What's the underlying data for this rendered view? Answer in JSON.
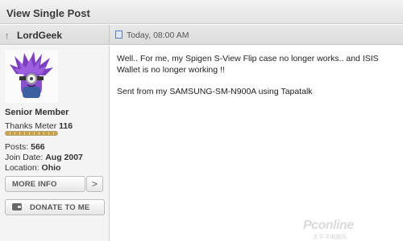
{
  "page": {
    "title": "View Single Post"
  },
  "post": {
    "author": "LordGeek",
    "timestamp": "Today, 08:00 AM",
    "body_line1": "Well.. For me, my Spigen S-View Flip case no longer works.. and ISIS",
    "body_line2": "Wallet is no longer working !!",
    "signature": "Sent from my SAMSUNG-SM-N900A using Tapatalk"
  },
  "user": {
    "rank": "Senior Member",
    "thanks_label": "Thanks Meter",
    "thanks_value": "116",
    "thanks_meter_fraction": 1.0,
    "posts_label": "Posts:",
    "posts_value": "566",
    "join_label": "Join Date:",
    "join_value": "Aug 2007",
    "location_label": "Location:",
    "location_value": "Ohio"
  },
  "buttons": {
    "more_info": "MORE INFO",
    "more_arrow": ">",
    "donate": "DONATE TO ME"
  },
  "icons": {
    "header": "arrow-up-icon",
    "timestamp": "document-icon",
    "donate": "wallet-icon"
  },
  "watermark": {
    "main": "Pconline",
    "sub": "太平洋电脑网"
  }
}
